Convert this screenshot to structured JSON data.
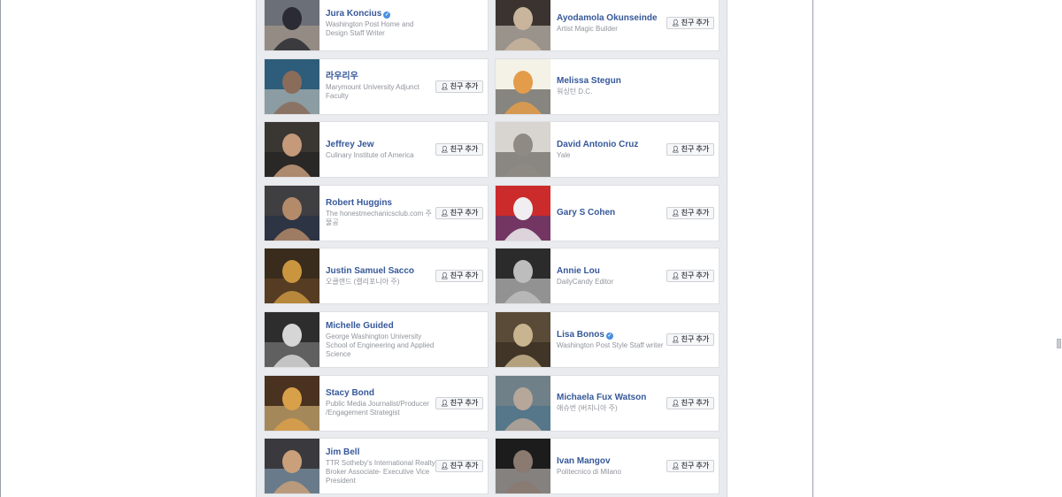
{
  "add_friend_label": "친구 추가",
  "people": [
    {
      "name": "Jura Koncius",
      "verified": true,
      "desc": "Washington Post Home and Design Staff Writer",
      "button": false
    },
    {
      "name": "Ayodamola Okunseinde",
      "verified": false,
      "desc": "Artist Magic Builder",
      "button": true
    },
    {
      "name": "라우리우",
      "verified": false,
      "desc": "Marymount University Adjunct Faculty",
      "button": true
    },
    {
      "name": "Melissa Stegun",
      "verified": false,
      "desc": "워싱턴 D.C.",
      "button": false
    },
    {
      "name": "Jeffrey Jew",
      "verified": false,
      "desc": "Culinary Institute of America",
      "button": true
    },
    {
      "name": "David Antonio Cruz",
      "verified": false,
      "desc": "Yale",
      "button": true
    },
    {
      "name": "Robert Huggins",
      "verified": false,
      "desc": "The honestmechanicsclub.com 주물공",
      "button": true
    },
    {
      "name": "Gary S Cohen",
      "verified": false,
      "desc": "",
      "button": true
    },
    {
      "name": "Justin Samuel Sacco",
      "verified": false,
      "desc": "오클랜드 (캘리포니아 주)",
      "button": true
    },
    {
      "name": "Annie Lou",
      "verified": false,
      "desc": "DailyCandy Editor",
      "button": true
    },
    {
      "name": "Michelle Guided",
      "verified": false,
      "desc": "George Washington University School of Engineering and Applied Science",
      "button": false
    },
    {
      "name": "Lisa Bonos",
      "verified": true,
      "desc": "Washington Post Style Staff writer",
      "button": true
    },
    {
      "name": "Stacy Bond",
      "verified": false,
      "desc": "Public Media Journalist/Producer /Engagement Strategist",
      "button": true
    },
    {
      "name": "Michaela Fux Watson",
      "verified": false,
      "desc": "애슈번 (버지니아 주)",
      "button": true
    },
    {
      "name": "Jim Bell",
      "verified": false,
      "desc": "TTR Sotheby's International Realty Broker Associate- Executive Vice President",
      "button": true
    },
    {
      "name": "Ivan Mangov",
      "verified": false,
      "desc": "Politecnico di Milano",
      "button": true
    }
  ],
  "photo_palettes": [
    [
      "#6b6f78",
      "#2b2b33",
      "#b7a48e"
    ],
    [
      "#3b3330",
      "#c9b49c",
      "#e8e2d8"
    ],
    [
      "#2d5d7a",
      "#8a6c5a",
      "#d9d0c4"
    ],
    [
      "#f4f1e6",
      "#e39c4a",
      "#2b2b2b"
    ],
    [
      "#3a3632",
      "#c49a7a",
      "#1d1d1d"
    ],
    [
      "#d8d4cf",
      "#8f8a84",
      "#4a4744"
    ],
    [
      "#3f3f42",
      "#b38a6a",
      "#1f2b46"
    ],
    [
      "#cc2b2b",
      "#f0eef0",
      "#2a3f8f"
    ],
    [
      "#3a2c1c",
      "#c9953f",
      "#6b4a2a"
    ],
    [
      "#2b2b2b",
      "#bdbdbd",
      "#e8e8e8"
    ],
    [
      "#2d2d2d",
      "#d6d6d6",
      "#8a8a8a"
    ],
    [
      "#5a4a38",
      "#c8b48e",
      "#2c2418"
    ],
    [
      "#4a3220",
      "#d9a04a",
      "#f0d08a"
    ],
    [
      "#6f8088",
      "#b7a69a",
      "#3f6f8a"
    ],
    [
      "#3a3a3e",
      "#c9a07a",
      "#8fb0c8"
    ],
    [
      "#1c1c1c",
      "#8a7a70",
      "#dcd6d0"
    ]
  ]
}
